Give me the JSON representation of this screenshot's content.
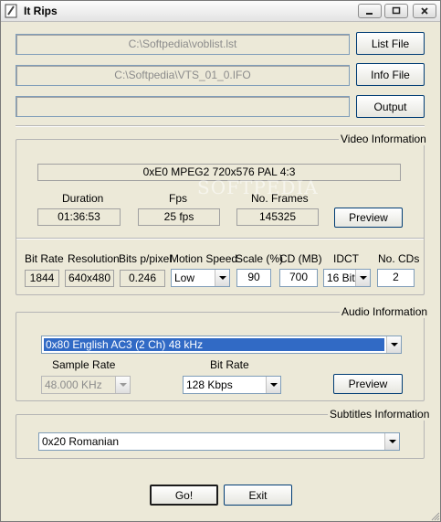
{
  "window": {
    "title": "It Rips"
  },
  "files": {
    "list_file_path": "C:\\Softpedia\\voblist.lst",
    "list_file_button": "List File",
    "info_file_path": "C:\\Softpedia\\VTS_01_0.IFO",
    "info_file_button": "Info File",
    "output_path": "",
    "output_button": "Output"
  },
  "video": {
    "group_label": "Video Information",
    "stream_info": "0xE0 MPEG2 720x576 PAL 4:3",
    "duration_label": "Duration",
    "duration_value": "01:36:53",
    "fps_label": "Fps",
    "fps_value": "25 fps",
    "frames_label": "No. Frames",
    "frames_value": "145325",
    "preview_button": "Preview",
    "bitrate_label": "Bit Rate",
    "bitrate_value": "1844",
    "resolution_label": "Resolution",
    "resolution_value": "640x480",
    "bpp_label": "Bits p/pixel",
    "bpp_value": "0.246",
    "motion_label": "Motion Speed",
    "motion_value": "Low",
    "scale_label": "Scale (%)",
    "scale_value": "90",
    "cd_label": "CD (MB)",
    "cd_value": "700",
    "idct_label": "IDCT",
    "idct_value": "16 Bit",
    "nocds_label": "No. CDs",
    "nocds_value": "2"
  },
  "audio": {
    "group_label": "Audio Information",
    "stream_selected": "0x80 English AC3 (2 Ch) 48 kHz",
    "sample_rate_label": "Sample Rate",
    "sample_rate_value": "48.000 KHz",
    "bitrate_label": "Bit Rate",
    "bitrate_value": "128 Kbps",
    "preview_button": "Preview"
  },
  "subtitles": {
    "group_label": "Subtitles Information",
    "selected": "0x20 Romanian"
  },
  "actions": {
    "go_button": "Go!",
    "exit_button": "Exit"
  },
  "watermark": "SOFTPEDIA",
  "colors": {
    "selection": "#316ac5",
    "window_bg": "#ece9d8"
  }
}
